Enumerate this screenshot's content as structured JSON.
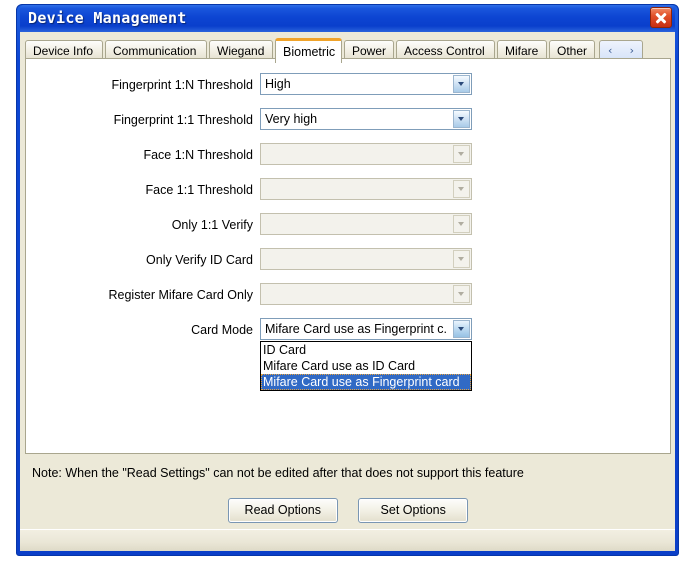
{
  "window": {
    "title": "Device Management",
    "close_label": "close-button"
  },
  "tabs": {
    "items": [
      {
        "label": "Device Info",
        "selected": false
      },
      {
        "label": "Communication",
        "selected": false
      },
      {
        "label": "Wiegand",
        "selected": false
      },
      {
        "label": "Biometric",
        "selected": true
      },
      {
        "label": "Power",
        "selected": false
      },
      {
        "label": "Access Control",
        "selected": false
      },
      {
        "label": "Mifare",
        "selected": false
      },
      {
        "label": "Other",
        "selected": false
      }
    ],
    "scroll_prev": "‹",
    "scroll_next": "›"
  },
  "form": {
    "rows": [
      {
        "label": "Fingerprint 1:N Threshold",
        "value": "High",
        "enabled": true,
        "open": false
      },
      {
        "label": "Fingerprint 1:1 Threshold",
        "value": "Very high",
        "enabled": true,
        "open": false
      },
      {
        "label": "Face 1:N Threshold",
        "value": "",
        "enabled": false,
        "open": false
      },
      {
        "label": "Face 1:1 Threshold",
        "value": "",
        "enabled": false,
        "open": false
      },
      {
        "label": "Only 1:1 Verify",
        "value": "",
        "enabled": false,
        "open": false
      },
      {
        "label": "Only Verify ID Card",
        "value": "",
        "enabled": false,
        "open": false
      },
      {
        "label": "Register Mifare Card Only",
        "value": "",
        "enabled": false,
        "open": false
      },
      {
        "label": "Card Mode",
        "value": "Mifare Card use as Fingerprint c.",
        "enabled": true,
        "open": true
      }
    ]
  },
  "dropdown": {
    "options": [
      {
        "label": "ID Card",
        "selected": false
      },
      {
        "label": "Mifare Card use as ID Card",
        "selected": false
      },
      {
        "label": "Mifare Card use as Fingerprint card",
        "selected": true
      }
    ]
  },
  "note": "Note: When the \"Read Settings\" can not be edited after that does not support this feature",
  "buttons": {
    "read": "Read Options",
    "set": "Set Options"
  },
  "colors": {
    "titlebar": "#0d45d2",
    "accent_tab": "#f0a32a",
    "selection": "#316ac5",
    "client_bg": "#ece9d8"
  }
}
